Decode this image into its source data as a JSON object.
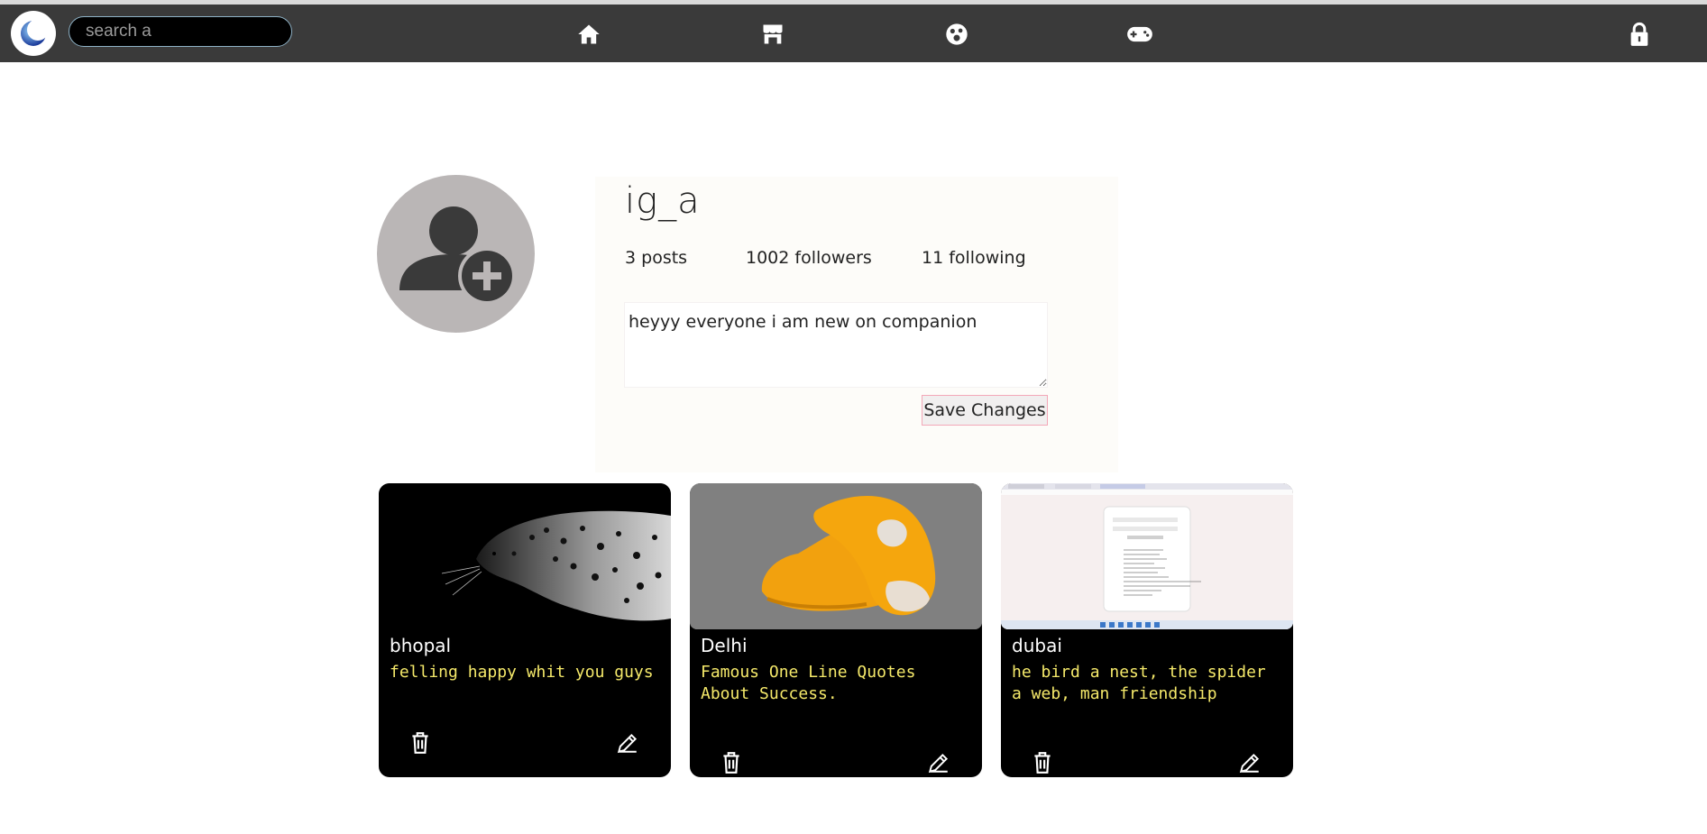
{
  "nav": {
    "search": {
      "placeholder": "search a",
      "value": ""
    },
    "icons": [
      "home-icon",
      "store-icon",
      "community-icon",
      "games-icon",
      "lock-icon"
    ]
  },
  "profile": {
    "username": "ig_a",
    "posts": "3 posts",
    "followers": "1002 followers",
    "following": "11 following",
    "bio": "heyyy everyone i am new on companion",
    "save_label": "Save Changes"
  },
  "posts": [
    {
      "place": "bhopal",
      "caption": "felling happy whit you guys",
      "image": "leopard"
    },
    {
      "place": "Delhi",
      "caption": "Famous One Line Quotes About Success.",
      "image": "orange-shoe"
    },
    {
      "place": "dubai",
      "caption": "he bird a nest, the spider a web, man friendship",
      "image": "browser-screenshot"
    }
  ],
  "colors": {
    "navbar": "#3a3a3a",
    "card_bg": "#000000",
    "caption": "#f5e96a",
    "avatar_bg": "#bab6b6"
  }
}
